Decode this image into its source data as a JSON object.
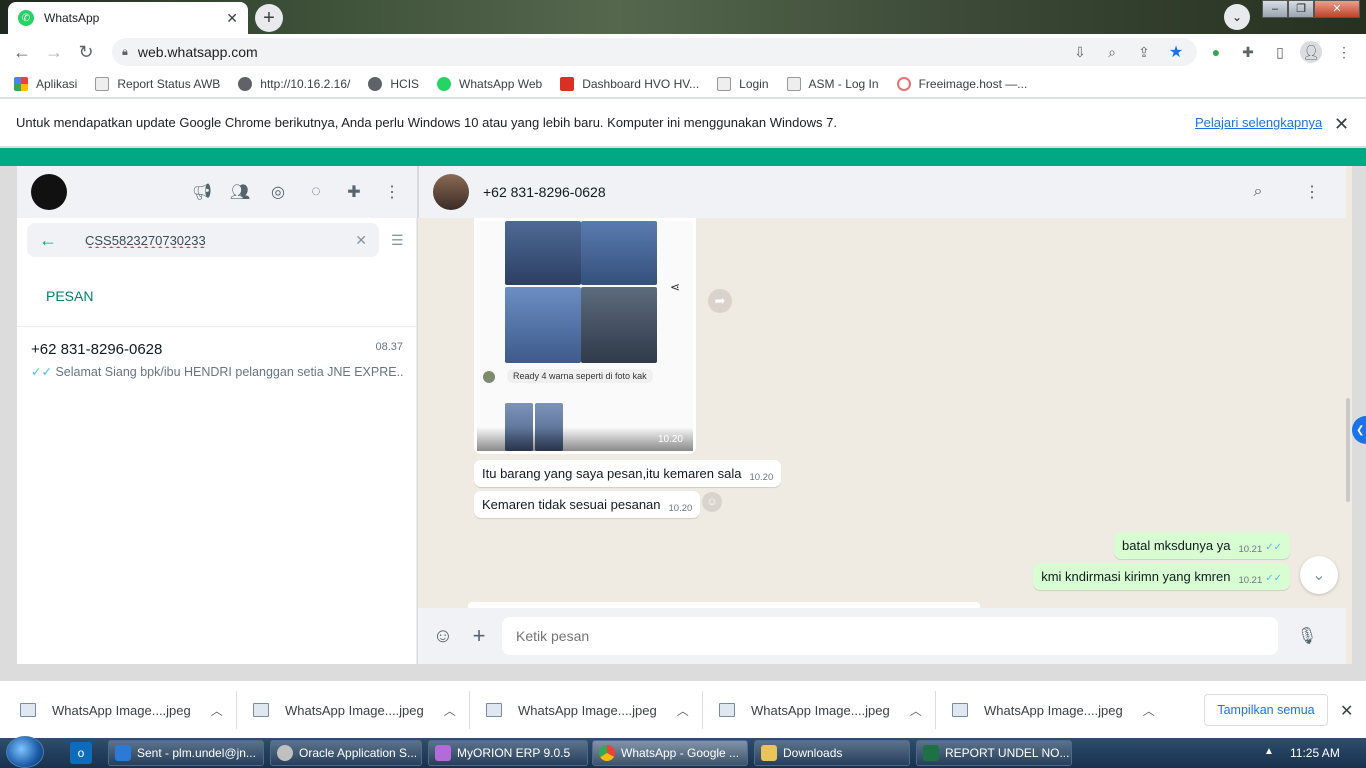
{
  "browser": {
    "tab_title": "WhatsApp",
    "url": "web.whatsapp.com",
    "bookmarks": [
      "Aplikasi",
      "Report Status AWB",
      "http://10.16.2.16/",
      "HCIS",
      "WhatsApp Web",
      "Dashboard HVO HV...",
      "Login",
      "ASM - Log In",
      "Freeimage.host —..."
    ],
    "infobar_text": "Untuk mendapatkan update Google Chrome berikutnya, Anda perlu Windows 10 atau yang lebih baru. Komputer ini menggunakan Windows 7.",
    "infobar_link": "Pelajari selengkapnya"
  },
  "left_panel": {
    "search_value": "CSS5823270730233",
    "section_label": "PESAN",
    "result": {
      "name": "+62 831-8296-0628",
      "time": "08.37",
      "preview": "Selamat Siang   bpk/ibu HENDRI pelanggan setia JNE EXPRE..."
    }
  },
  "chat": {
    "contact_name": "+62 831-8296-0628",
    "image_caption": "Ready 4 warna seperti di foto kak",
    "image_time": "10.20",
    "messages": [
      {
        "dir": "in",
        "text": "Itu barang yang saya pesan,itu kemaren sala",
        "time": "10.20"
      },
      {
        "dir": "in",
        "text": "Kemaren tidak sesuai pesanan",
        "time": "10.20"
      },
      {
        "dir": "out",
        "text": "batal mksdunya ya",
        "time": "10.21"
      },
      {
        "dir": "out",
        "text": "kmi kndirmasi kirimn yang kmren",
        "time": "10.21"
      }
    ],
    "compose_placeholder": "Ketik pesan"
  },
  "downloads": {
    "items": [
      "WhatsApp Image....jpeg",
      "WhatsApp Image....jpeg",
      "WhatsApp Image....jpeg",
      "WhatsApp Image....jpeg",
      "WhatsApp Image....jpeg"
    ],
    "show_all": "Tampilkan semua"
  },
  "taskbar": {
    "items": [
      "Sent - plm.undel@jn...",
      "Oracle Application S...",
      "MyORION ERP 9.0.5",
      "WhatsApp - Google ...",
      "Downloads",
      "REPORT UNDEL NO..."
    ],
    "clock": "11:25 AM"
  },
  "colors": {
    "wa_green": "#00a884",
    "out_bubble": "#d9fdd3",
    "tick_blue": "#53bdeb",
    "link_blue": "#1a73e8"
  }
}
